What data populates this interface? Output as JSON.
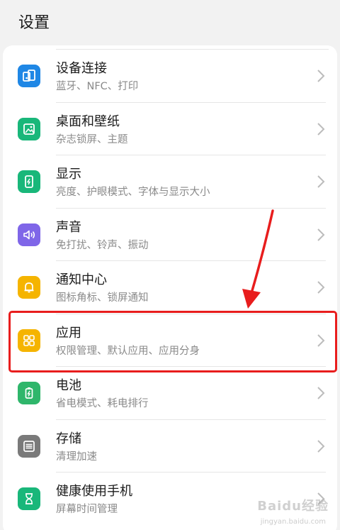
{
  "header": {
    "title": "设置"
  },
  "items": [
    {
      "title": "设备连接",
      "sub": "蓝牙、NFC、打印",
      "color": "#1f87e5",
      "icon": "device-connection-icon"
    },
    {
      "title": "桌面和壁纸",
      "sub": "杂志锁屏、主题",
      "color": "#19b77a",
      "icon": "wallpaper-icon"
    },
    {
      "title": "显示",
      "sub": "亮度、护眼模式、字体与显示大小",
      "color": "#19b77a",
      "icon": "display-icon"
    },
    {
      "title": "声音",
      "sub": "免打扰、铃声、振动",
      "color": "#7f66e8",
      "icon": "sound-icon"
    },
    {
      "title": "通知中心",
      "sub": "图标角标、锁屏通知",
      "color": "#f5b400",
      "icon": "bell-icon"
    },
    {
      "title": "应用",
      "sub": "权限管理、默认应用、应用分身",
      "color": "#f5b400",
      "icon": "apps-grid-icon"
    },
    {
      "title": "电池",
      "sub": "省电模式、耗电排行",
      "color": "#2fb66b",
      "icon": "battery-icon"
    },
    {
      "title": "存储",
      "sub": "清理加速",
      "color": "#7a7a7a",
      "icon": "storage-icon"
    },
    {
      "title": "健康使用手机",
      "sub": "屏幕时间管理",
      "color": "#19b77a",
      "icon": "hourglass-icon"
    }
  ],
  "annotation": {
    "highlight_color": "#e81d1d"
  },
  "watermark": {
    "brand": "Baidu经验",
    "url": "jingyan.baidu.com"
  }
}
